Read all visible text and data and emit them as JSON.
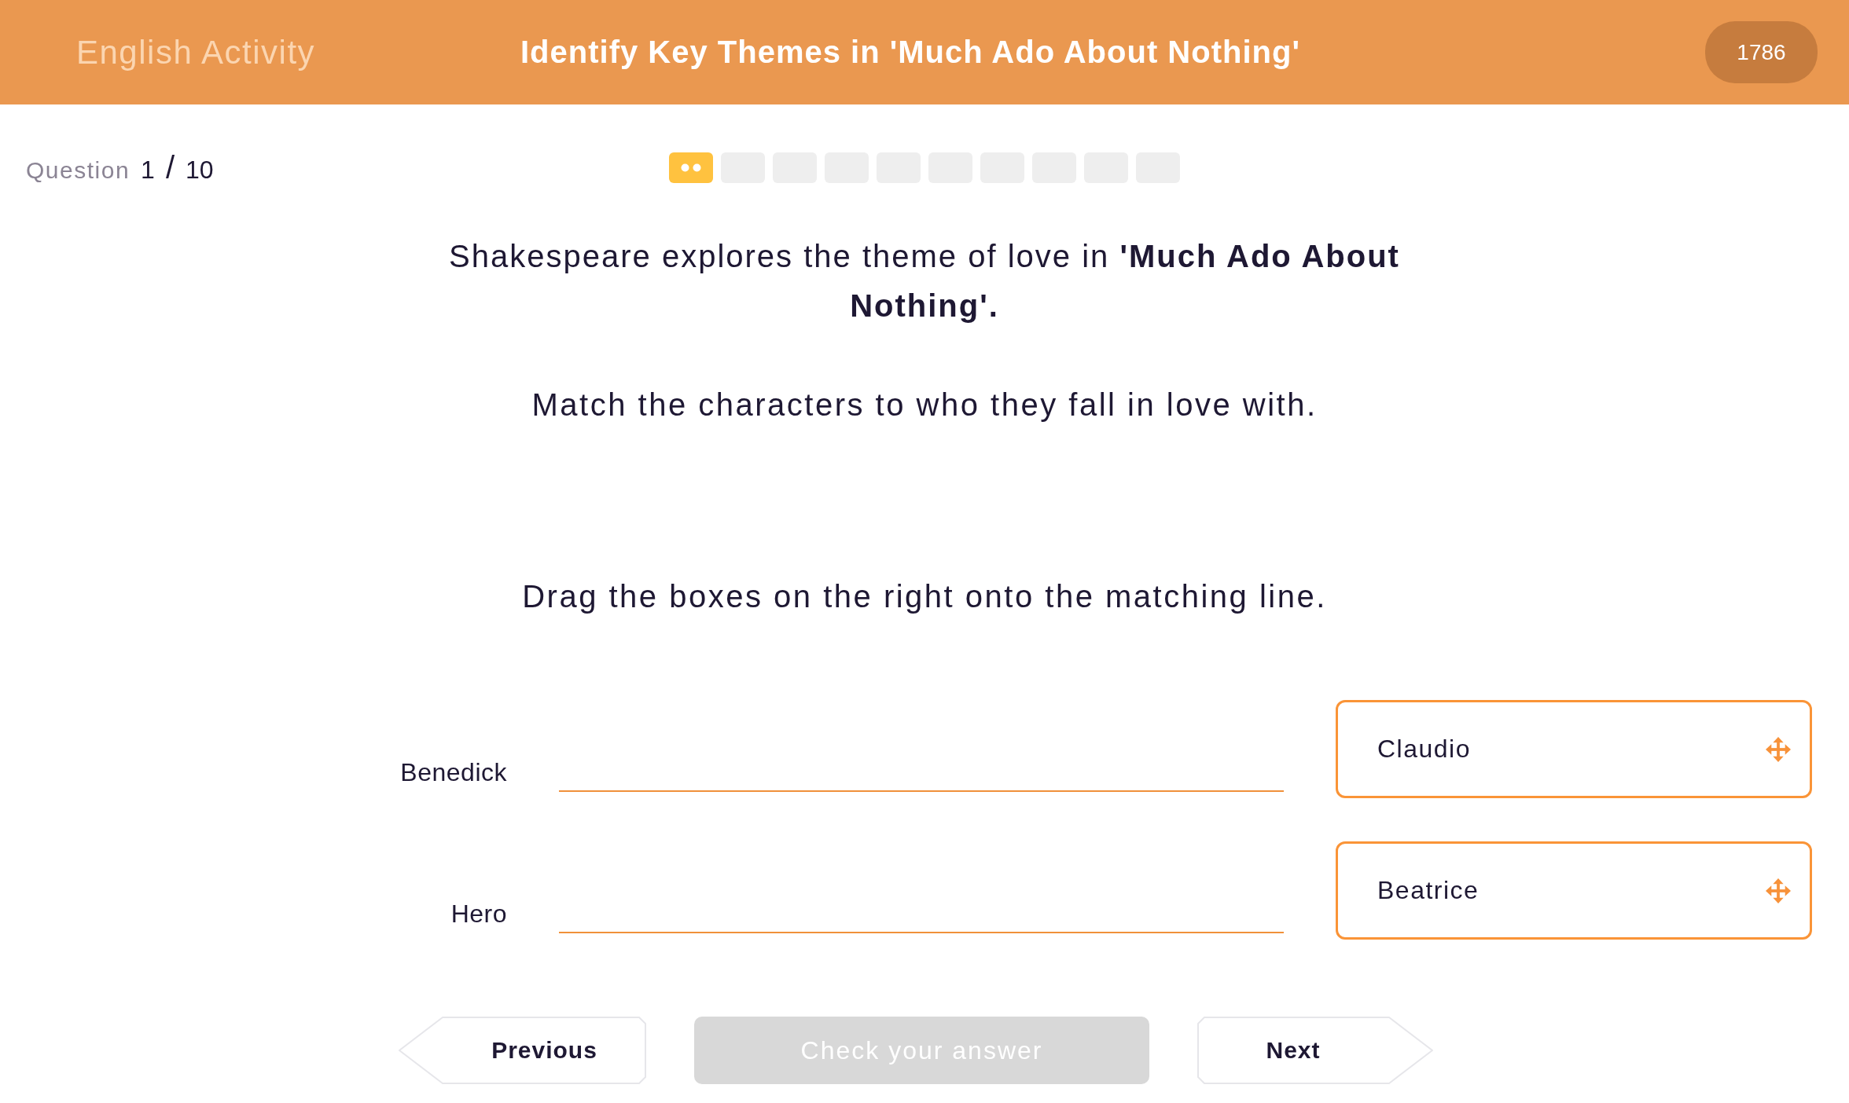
{
  "header": {
    "subject": "English Activity",
    "title": "Identify Key Themes in 'Much Ado About Nothing'",
    "score": "1786"
  },
  "question_counter": {
    "label": "Question",
    "current": "1",
    "separator": "/",
    "total": "10"
  },
  "progress": [
    {
      "current": true
    },
    {
      "current": false
    },
    {
      "current": false
    },
    {
      "current": false
    },
    {
      "current": false
    },
    {
      "current": false
    },
    {
      "current": false
    },
    {
      "current": false
    },
    {
      "current": false
    },
    {
      "current": false
    }
  ],
  "question": {
    "prompt": "Shakespeare explores the theme of love in **'Much Ado About Nothing'.**",
    "instruction": "Match the characters to who they fall in love with.",
    "hint": "Drag the boxes on the right onto the matching line."
  },
  "matching": {
    "targets": [
      {
        "label": "Benedick"
      },
      {
        "label": "Hero"
      }
    ],
    "options": [
      {
        "label": "Claudio"
      },
      {
        "label": "Beatrice"
      }
    ]
  },
  "buttons": [
    {
      "kind": "previous",
      "label": "Previous",
      "disabled": false
    },
    {
      "kind": "check",
      "label": "Check your answer",
      "disabled": true
    },
    {
      "kind": "next",
      "label": "Next",
      "disabled": false
    }
  ]
}
